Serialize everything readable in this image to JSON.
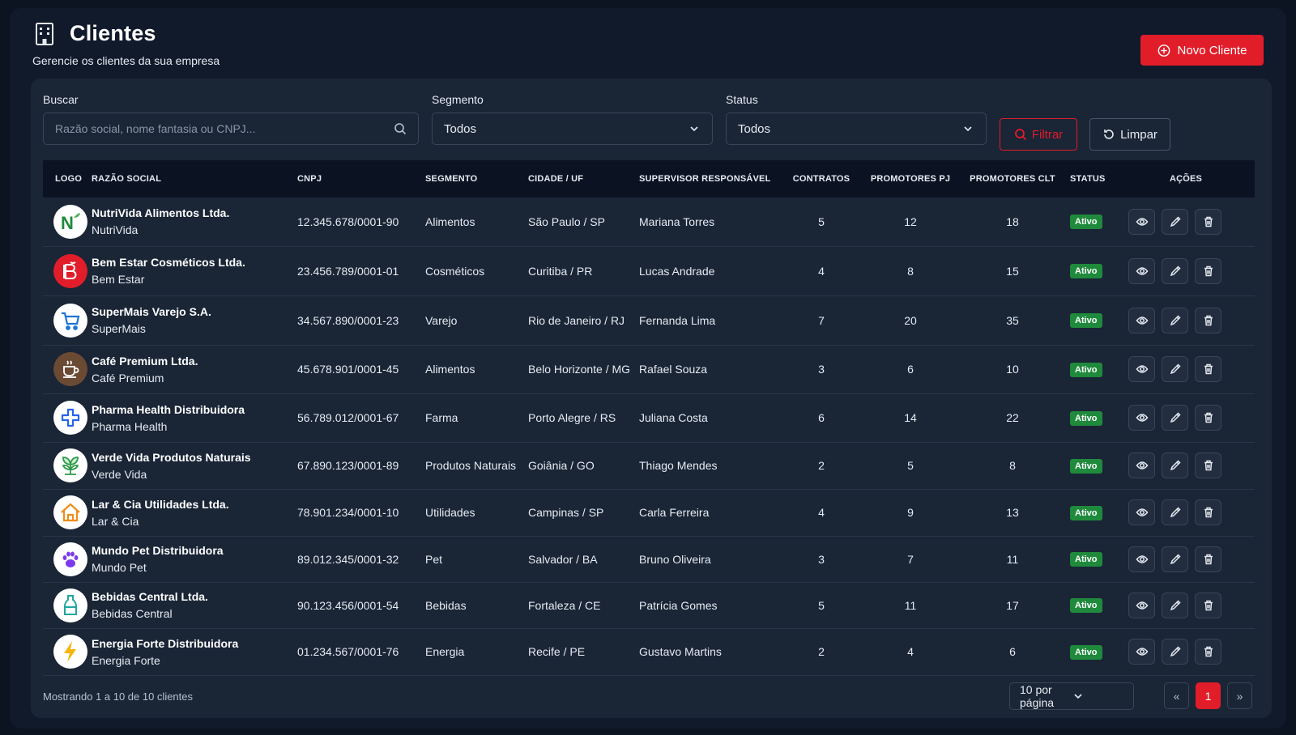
{
  "header": {
    "title": "Clientes",
    "subtitle": "Gerencie os clientes da sua empresa",
    "new_button": "Novo Cliente"
  },
  "filters": {
    "search_label": "Buscar",
    "search_placeholder": "Razão social, nome fantasia ou CNPJ...",
    "segment_label": "Segmento",
    "segment_value": "Todos",
    "status_label": "Status",
    "status_value": "Todos",
    "filter_button": "Filtrar",
    "clear_button": "Limpar"
  },
  "table": {
    "columns": [
      "LOGO",
      "RAZÃO SOCIAL",
      "CNPJ",
      "SEGMENTO",
      "CIDADE / UF",
      "SUPERVISOR RESPONSÁVEL",
      "CONTRATOS",
      "PROMOTORES PJ",
      "PROMOTORES CLT",
      "STATUS",
      "AÇÕES"
    ],
    "rows": [
      {
        "razao": "NutriVida Alimentos Ltda.",
        "fantasia": "NutriVida",
        "cnpj": "12.345.678/0001-90",
        "segmento": "Alimentos",
        "cidade": "São Paulo / SP",
        "supervisor": "Mariana Torres",
        "contratos": "5",
        "pj": "12",
        "clt": "18",
        "status": "Ativo",
        "logo_icon": "nutrivida-logo-icon",
        "logo_bg": "#ffffff"
      },
      {
        "razao": "Bem Estar Cosméticos Ltda.",
        "fantasia": "Bem Estar",
        "cnpj": "23.456.789/0001-01",
        "segmento": "Cosméticos",
        "cidade": "Curitiba / PR",
        "supervisor": "Lucas Andrade",
        "contratos": "4",
        "pj": "8",
        "clt": "15",
        "status": "Ativo",
        "logo_icon": "bem-estar-logo-icon",
        "logo_bg": "#e11d2a"
      },
      {
        "razao": "SuperMais Varejo S.A.",
        "fantasia": "SuperMais",
        "cnpj": "34.567.890/0001-23",
        "segmento": "Varejo",
        "cidade": "Rio de Janeiro / RJ",
        "supervisor": "Fernanda Lima",
        "contratos": "7",
        "pj": "20",
        "clt": "35",
        "status": "Ativo",
        "logo_icon": "shopping-cart-icon",
        "logo_bg": "#ffffff"
      },
      {
        "razao": "Café Premium Ltda.",
        "fantasia": "Café Premium",
        "cnpj": "45.678.901/0001-45",
        "segmento": "Alimentos",
        "cidade": "Belo Horizonte / MG",
        "supervisor": "Rafael Souza",
        "contratos": "3",
        "pj": "6",
        "clt": "10",
        "status": "Ativo",
        "logo_icon": "coffee-cup-icon",
        "logo_bg": "#6b4a34"
      },
      {
        "razao": "Pharma Health Distribuidora",
        "fantasia": "Pharma Health",
        "cnpj": "56.789.012/0001-67",
        "segmento": "Farma",
        "cidade": "Porto Alegre / RS",
        "supervisor": "Juliana Costa",
        "contratos": "6",
        "pj": "14",
        "clt": "22",
        "status": "Ativo",
        "logo_icon": "medical-cross-icon",
        "logo_bg": "#ffffff"
      },
      {
        "razao": "Verde Vida Produtos Naturais",
        "fantasia": "Verde Vida",
        "cnpj": "67.890.123/0001-89",
        "segmento": "Produtos Naturais",
        "cidade": "Goiânia / GO",
        "supervisor": "Thiago Mendes",
        "contratos": "2",
        "pj": "5",
        "clt": "8",
        "status": "Ativo",
        "logo_icon": "plant-icon",
        "logo_bg": "#ffffff"
      },
      {
        "razao": "Lar & Cia Utilidades Ltda.",
        "fantasia": "Lar & Cia",
        "cnpj": "78.901.234/0001-10",
        "segmento": "Utilidades",
        "cidade": "Campinas / SP",
        "supervisor": "Carla Ferreira",
        "contratos": "4",
        "pj": "9",
        "clt": "13",
        "status": "Ativo",
        "logo_icon": "house-icon",
        "logo_bg": "#ffffff"
      },
      {
        "razao": "Mundo Pet Distribuidora",
        "fantasia": "Mundo Pet",
        "cnpj": "89.012.345/0001-32",
        "segmento": "Pet",
        "cidade": "Salvador / BA",
        "supervisor": "Bruno Oliveira",
        "contratos": "3",
        "pj": "7",
        "clt": "11",
        "status": "Ativo",
        "logo_icon": "paw-icon",
        "logo_bg": "#ffffff"
      },
      {
        "razao": "Bebidas Central Ltda.",
        "fantasia": "Bebidas Central",
        "cnpj": "90.123.456/0001-54",
        "segmento": "Bebidas",
        "cidade": "Fortaleza / CE",
        "supervisor": "Patrícia Gomes",
        "contratos": "5",
        "pj": "11",
        "clt": "17",
        "status": "Ativo",
        "logo_icon": "bottle-icon",
        "logo_bg": "#ffffff"
      },
      {
        "razao": "Energia Forte Distribuidora",
        "fantasia": "Energia Forte",
        "cnpj": "01.234.567/0001-76",
        "segmento": "Energia",
        "cidade": "Recife / PE",
        "supervisor": "Gustavo Martins",
        "contratos": "2",
        "pj": "4",
        "clt": "6",
        "status": "Ativo",
        "logo_icon": "lightning-icon",
        "logo_bg": "#ffffff"
      }
    ]
  },
  "footer": {
    "showing": "Mostrando 1 a 10 de 10 clientes",
    "per_page": "10 por página",
    "prev": "«",
    "page": "1",
    "next": "»"
  },
  "colors": {
    "accent": "#e11d2a",
    "status_active": "#1f8a3c",
    "background": "#111a2b",
    "panel": "#1a2536"
  }
}
